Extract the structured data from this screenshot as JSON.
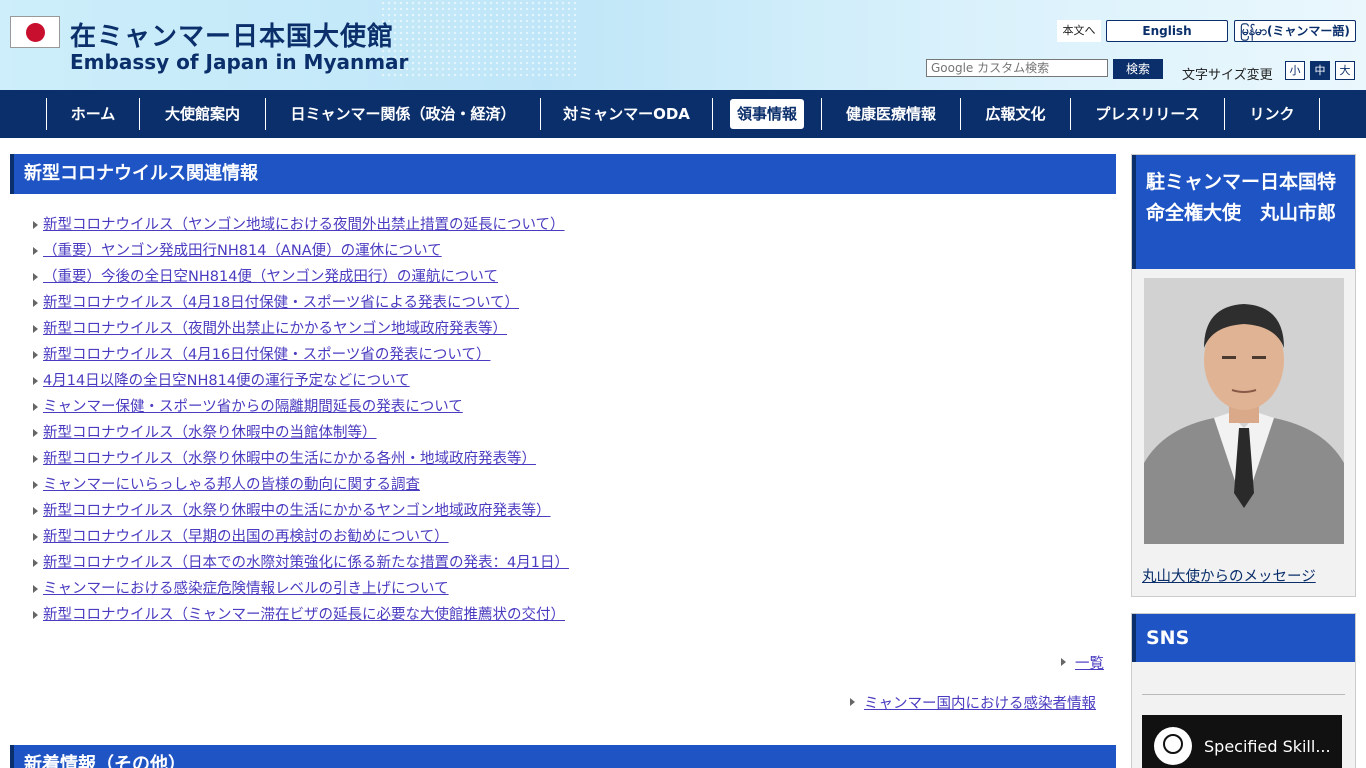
{
  "header": {
    "title_ja": "在ミャンマー日本国大使館",
    "title_en": "Embassy of Japan in Myanmar",
    "skip_link": "本文へ",
    "lang_en": "English",
    "lang_my": "မြန်မာ(ミャンマー語)",
    "search_placeholder": "Google カスタム検索",
    "search_button": "検索",
    "font_size_label": "文字サイズ変更",
    "font_sizes": [
      "小",
      "中",
      "大"
    ]
  },
  "nav": [
    "ホーム",
    "大使館案内",
    "日ミャンマー関係（政治・経済）",
    "対ミャンマーODA",
    "領事情報",
    "健康医療情報",
    "広報文化",
    "プレスリリース",
    "リンク"
  ],
  "main": {
    "corona_heading": "新型コロナウイルス関連情報",
    "items": [
      "新型コロナウイルス（ヤンゴン地域における夜間外出禁止措置の延長について）",
      "（重要）ヤンゴン発成田行NH814（ANA便）の運休について",
      "（重要）今後の全日空NH814便（ヤンゴン発成田行）の運航について",
      "新型コロナウイルス（4月18日付保健・スポーツ省による発表について）",
      "新型コロナウイルス（夜間外出禁止にかかるヤンゴン地域政府発表等）",
      "新型コロナウイルス（4月16日付保健・スポーツ省の発表について）",
      "4月14日以降の全日空NH814便の運行予定などについて",
      "ミャンマー保健・スポーツ省からの隔離期間延長の発表について",
      "新型コロナウイルス（水祭り休暇中の当館体制等）",
      "新型コロナウイルス（水祭り休暇中の生活にかかる各州・地域政府発表等）",
      "ミャンマーにいらっしゃる邦人の皆様の動向に関する調査",
      "新型コロナウイルス（水祭り休暇中の生活にかかるヤンゴン地域政府発表等）",
      "新型コロナウイルス（早期の出国の再検討のお勧めについて）",
      "新型コロナウイルス（日本での水際対策強化に係る新たな措置の発表：4月1日）",
      "ミャンマーにおける感染症危険情報レベルの引き上げについて",
      "新型コロナウイルス（ミャンマー滞在ビザの延長に必要な大使館推薦状の交付）"
    ],
    "list_link": "一覧",
    "infection_link": "ミャンマー国内における感染者情報",
    "news_heading": "新着情報（その他）"
  },
  "sidebar": {
    "ambassador_title": "駐ミャンマー日本国特命全権大使　丸山市郎",
    "ambassador_message": "丸山大使からのメッセージ",
    "sns_heading": "SNS",
    "video_title": "Specified Skill..."
  },
  "colors": {
    "navy": "#0b2f6b",
    "heading_blue": "#1f54c4",
    "link": "#4a3cc0"
  }
}
